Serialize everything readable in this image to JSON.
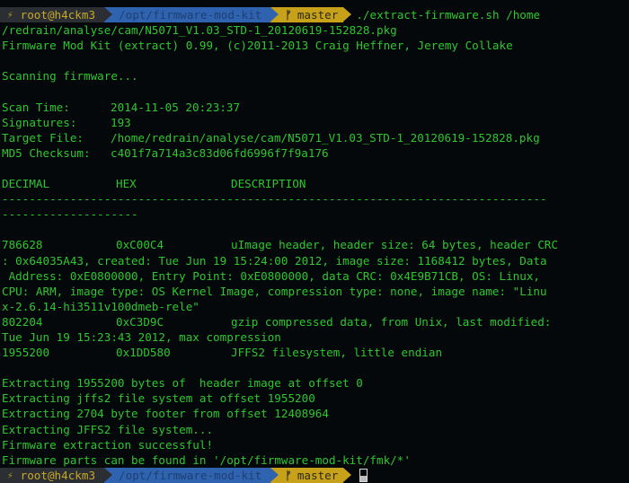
{
  "prompt_top": {
    "user_host": "root@h4ckm3",
    "cwd": "/opt/firmware-mod-kit",
    "branch": "master",
    "command": "./extract-firmware.sh /home"
  },
  "output": {
    "command_wrap": "/redrain/analyse/cam/N5071_V1.03_STD-1_20120619-152828.pkg",
    "banner": "Firmware Mod Kit (extract) 0.99, (c)2011-2013 Craig Heffner, Jeremy Collake",
    "scanning": "Scanning firmware...",
    "scan_info": [
      {
        "key": "Scan Time:",
        "value": "2014-11-05 20:23:37"
      },
      {
        "key": "Signatures:",
        "value": "193"
      },
      {
        "key": "Target File:",
        "value": "/home/redrain/analyse/cam/N5071_V1.03_STD-1_20120619-152828.pkg"
      },
      {
        "key": "MD5 Checksum:",
        "value": "c401f7a714a3c83d06fd6996f7f9a176"
      }
    ],
    "table_headers": {
      "decimal": "DECIMAL",
      "hex": "HEX",
      "description": "DESCRIPTION"
    },
    "separator_1": "--------------------------------------------------------------------------------",
    "separator_2": "--------------------",
    "rows": [
      {
        "decimal": "786628",
        "hex": "0xC00C4",
        "description": "uImage header, header size: 64 bytes, header CRC",
        "wrap": [
          ": 0x64035A43, created: Tue Jun 19 15:24:00 2012, image size: 1168412 bytes, Data",
          " Address: 0xE0800000, Entry Point: 0xE0800000, data CRC: 0x4E9B71CB, OS: Linux,",
          "CPU: ARM, image type: OS Kernel Image, compression type: none, image name: \"Linu",
          "x-2.6.14-hi3511v100dmeb-rele\""
        ]
      },
      {
        "decimal": "802204",
        "hex": "0xC3D9C",
        "description": "gzip compressed data, from Unix, last modified:",
        "wrap": [
          "Tue Jun 19 15:23:43 2012, max compression"
        ]
      },
      {
        "decimal": "1955200",
        "hex": "0x1DD580",
        "description": "JFFS2 filesystem, little endian",
        "wrap": []
      }
    ],
    "extract_lines": [
      "Extracting 1955200 bytes of  header image at offset 0",
      "Extracting jffs2 file system at offset 1955200",
      "Extracting 2704 byte footer from offset 12408964",
      "Extracting JFFS2 file system...",
      "Firmware extraction successful!",
      "Firmware parts can be found in '/opt/firmware-mod-kit/fmk/*'"
    ]
  },
  "prompt_bottom": {
    "user_host": "root@h4ckm3",
    "cwd": "/opt/firmware-mod-kit",
    "branch": "master"
  },
  "icons": {
    "bolt": "⚡",
    "branch": "ᚠ"
  },
  "colors": {
    "background": "#05080b",
    "text_green": "#2fc52f",
    "user_segment": "#2b2f33",
    "path_segment": "#2f63b0",
    "git_segment": "#c8a11a"
  }
}
